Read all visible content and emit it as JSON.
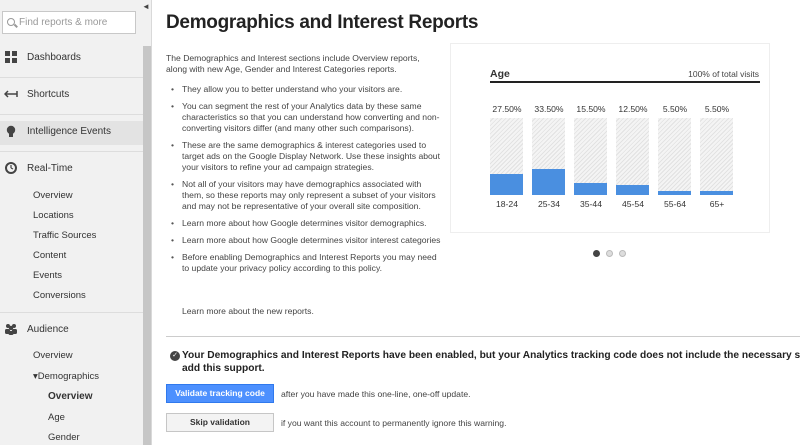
{
  "sidebar": {
    "search_placeholder": "Find reports & more",
    "collapse_glyph": "◄",
    "top_items": [
      {
        "label": "Dashboards",
        "icon": "grid-icon"
      },
      {
        "label": "Shortcuts",
        "icon": "shortcut-arrow-icon"
      },
      {
        "label": "Intelligence Events",
        "icon": "lightbulb-icon"
      },
      {
        "label": "Real-Time",
        "icon": "clock-icon"
      },
      {
        "label": "Audience",
        "icon": "people-icon"
      }
    ],
    "realtime_items": [
      "Overview",
      "Locations",
      "Traffic Sources",
      "Content",
      "Events",
      "Conversions"
    ],
    "audience_items": {
      "overview": "Overview",
      "demographics": "▾Demographics",
      "demographics_children": [
        "Overview",
        "Age",
        "Gender"
      ]
    }
  },
  "main": {
    "title": "Demographics and Interest Reports",
    "intro": "The Demographics and Interest sections include Overview reports, along with new Age, Gender and Interest Categories reports.",
    "bullets": [
      "They allow you to better understand who your visitors are.",
      "You can segment the rest of your Analytics data by these same characteristics so that you can understand how converting and non-converting visitors differ (and many other such comparisons).",
      "These are the same demographics & interest categories used to target ads on the Google Display Network. Use these insights about your visitors to refine your ad campaign strategies.",
      "Not all of your visitors may have demographics associated with them, so these reports may only represent a subset of your visitors and may not be representative of your overall site composition.",
      "Learn more about how Google determines visitor demographics.",
      "Learn more about how Google determines visitor interest categories",
      "Before enabling Demographics and Interest Reports you may need to update your privacy policy according to this policy."
    ],
    "learn_more": "Learn more about the new reports.",
    "notice_line1": "Your Demographics and Interest Reports have been enabled, but your Analytics tracking code does not include the necessary sup",
    "notice_line2": "add this support.",
    "validate_button": "Validate tracking code",
    "validate_text": "after you have made this one-line, one-off update.",
    "skip_button": "Skip validation",
    "skip_text": "if you want this account to permanently ignore this warning.",
    "carousel_active_index": 0,
    "carousel_count": 3
  },
  "chart_data": {
    "type": "bar",
    "title": "Age",
    "subtitle": "100% of total visits",
    "categories": [
      "18-24",
      "25-34",
      "35-44",
      "45-54",
      "55-64",
      "65+"
    ],
    "values": [
      27.5,
      33.5,
      15.5,
      12.5,
      5.5,
      5.5
    ],
    "value_labels": [
      "27.50%",
      "33.50%",
      "15.50%",
      "12.50%",
      "5.50%",
      "5.50%"
    ],
    "ylim": [
      0,
      100
    ],
    "bar_color": "#4a8fe0"
  }
}
